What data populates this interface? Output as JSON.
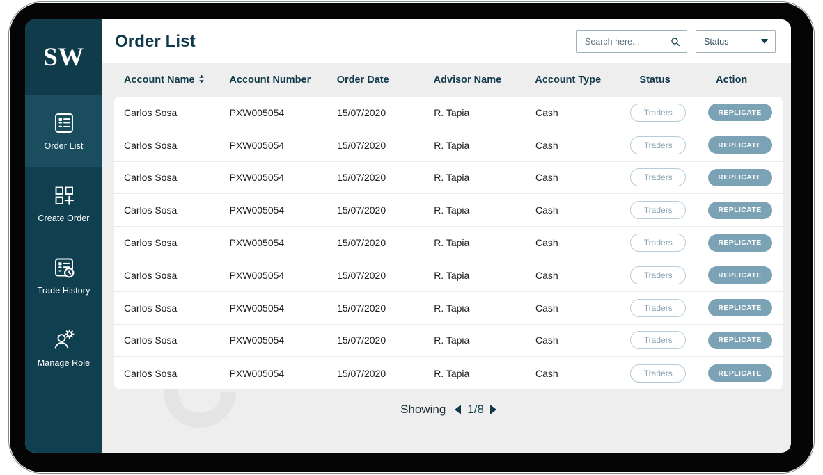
{
  "brand": {
    "logo_text": "SW"
  },
  "sidebar": {
    "items": [
      {
        "label": "Order List",
        "icon": "list-document-icon",
        "active": true
      },
      {
        "label": "Create Order",
        "icon": "grid-plus-icon",
        "active": false
      },
      {
        "label": "Trade History",
        "icon": "document-clock-icon",
        "active": false
      },
      {
        "label": "Manage Role",
        "icon": "user-gear-icon",
        "active": false
      }
    ]
  },
  "header": {
    "title": "Order List",
    "search": {
      "value": "",
      "placeholder": "Search here...",
      "icon": "search-icon"
    },
    "status_filter": {
      "selected": "Status",
      "icon": "chevron-down-icon"
    }
  },
  "table": {
    "columns": [
      {
        "label": "Account Name",
        "sortable": true,
        "key": "account_name"
      },
      {
        "label": "Account Number",
        "sortable": false,
        "key": "account_number"
      },
      {
        "label": "Order Date",
        "sortable": false,
        "key": "order_date"
      },
      {
        "label": "Advisor Name",
        "sortable": false,
        "key": "advisor_name"
      },
      {
        "label": "Account Type",
        "sortable": false,
        "key": "account_type"
      },
      {
        "label": "Status",
        "sortable": false,
        "key": "status"
      },
      {
        "label": "Action",
        "sortable": false,
        "key": "action"
      }
    ],
    "rows": [
      {
        "account_name": "Carlos Sosa",
        "account_number": "PXW005054",
        "order_date": "15/07/2020",
        "advisor_name": "R. Tapia",
        "account_type": "Cash",
        "status": "Traders",
        "action": "REPLICATE"
      },
      {
        "account_name": "Carlos Sosa",
        "account_number": "PXW005054",
        "order_date": "15/07/2020",
        "advisor_name": "R. Tapia",
        "account_type": "Cash",
        "status": "Traders",
        "action": "REPLICATE"
      },
      {
        "account_name": "Carlos Sosa",
        "account_number": "PXW005054",
        "order_date": "15/07/2020",
        "advisor_name": "R. Tapia",
        "account_type": "Cash",
        "status": "Traders",
        "action": "REPLICATE"
      },
      {
        "account_name": "Carlos Sosa",
        "account_number": "PXW005054",
        "order_date": "15/07/2020",
        "advisor_name": "R. Tapia",
        "account_type": "Cash",
        "status": "Traders",
        "action": "REPLICATE"
      },
      {
        "account_name": "Carlos Sosa",
        "account_number": "PXW005054",
        "order_date": "15/07/2020",
        "advisor_name": "R. Tapia",
        "account_type": "Cash",
        "status": "Traders",
        "action": "REPLICATE"
      },
      {
        "account_name": "Carlos Sosa",
        "account_number": "PXW005054",
        "order_date": "15/07/2020",
        "advisor_name": "R. Tapia",
        "account_type": "Cash",
        "status": "Traders",
        "action": "REPLICATE"
      },
      {
        "account_name": "Carlos Sosa",
        "account_number": "PXW005054",
        "order_date": "15/07/2020",
        "advisor_name": "R. Tapia",
        "account_type": "Cash",
        "status": "Traders",
        "action": "REPLICATE"
      },
      {
        "account_name": "Carlos Sosa",
        "account_number": "PXW005054",
        "order_date": "15/07/2020",
        "advisor_name": "R. Tapia",
        "account_type": "Cash",
        "status": "Traders",
        "action": "REPLICATE"
      },
      {
        "account_name": "Carlos Sosa",
        "account_number": "PXW005054",
        "order_date": "15/07/2020",
        "advisor_name": "R. Tapia",
        "account_type": "Cash",
        "status": "Traders",
        "action": "REPLICATE"
      }
    ]
  },
  "pagination": {
    "label": "Showing",
    "page_text": "1/8",
    "prev_icon": "triangle-left-icon",
    "next_icon": "triangle-right-icon"
  },
  "colors": {
    "sidebar": "#103f4f",
    "sidebar_active": "#1a4d5e",
    "title": "#10394a",
    "replicate_button": "#7ba2b5",
    "pill_border": "#b6ccd8",
    "pill_text": "#8aa4b3",
    "page_background": "#eeeeee"
  }
}
